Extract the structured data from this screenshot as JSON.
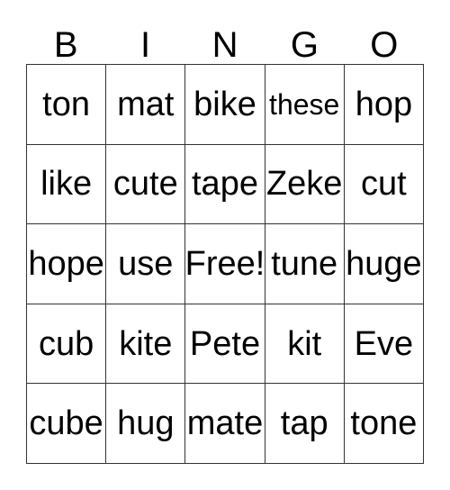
{
  "card": {
    "header_letters": [
      "B",
      "I",
      "N",
      "G",
      "O"
    ],
    "grid_size": "5x5",
    "free_space_label": "Free!",
    "colors": {
      "background": "#ffffff",
      "text": "#000000",
      "grid_line": "#333333"
    },
    "rows": [
      [
        {
          "label": "ton",
          "fit": "normal"
        },
        {
          "label": "mat",
          "fit": "normal"
        },
        {
          "label": "bike",
          "fit": "normal"
        },
        {
          "label": "these",
          "fit": "shrink"
        },
        {
          "label": "hop",
          "fit": "normal"
        }
      ],
      [
        {
          "label": "like",
          "fit": "normal"
        },
        {
          "label": "cute",
          "fit": "normal"
        },
        {
          "label": "tape",
          "fit": "normal"
        },
        {
          "label": "Zeke",
          "fit": "normal"
        },
        {
          "label": "cut",
          "fit": "normal"
        }
      ],
      [
        {
          "label": "hope",
          "fit": "normal"
        },
        {
          "label": "use",
          "fit": "normal"
        },
        {
          "label": "Free!",
          "fit": "normal"
        },
        {
          "label": "tune",
          "fit": "normal"
        },
        {
          "label": "huge",
          "fit": "normal"
        }
      ],
      [
        {
          "label": "cub",
          "fit": "normal"
        },
        {
          "label": "kite",
          "fit": "normal"
        },
        {
          "label": "Pete",
          "fit": "normal"
        },
        {
          "label": "kit",
          "fit": "normal"
        },
        {
          "label": "Eve",
          "fit": "normal"
        }
      ],
      [
        {
          "label": "cube",
          "fit": "normal"
        },
        {
          "label": "hug",
          "fit": "normal"
        },
        {
          "label": "mate",
          "fit": "normal"
        },
        {
          "label": "tap",
          "fit": "normal"
        },
        {
          "label": "tone",
          "fit": "normal"
        }
      ]
    ]
  }
}
